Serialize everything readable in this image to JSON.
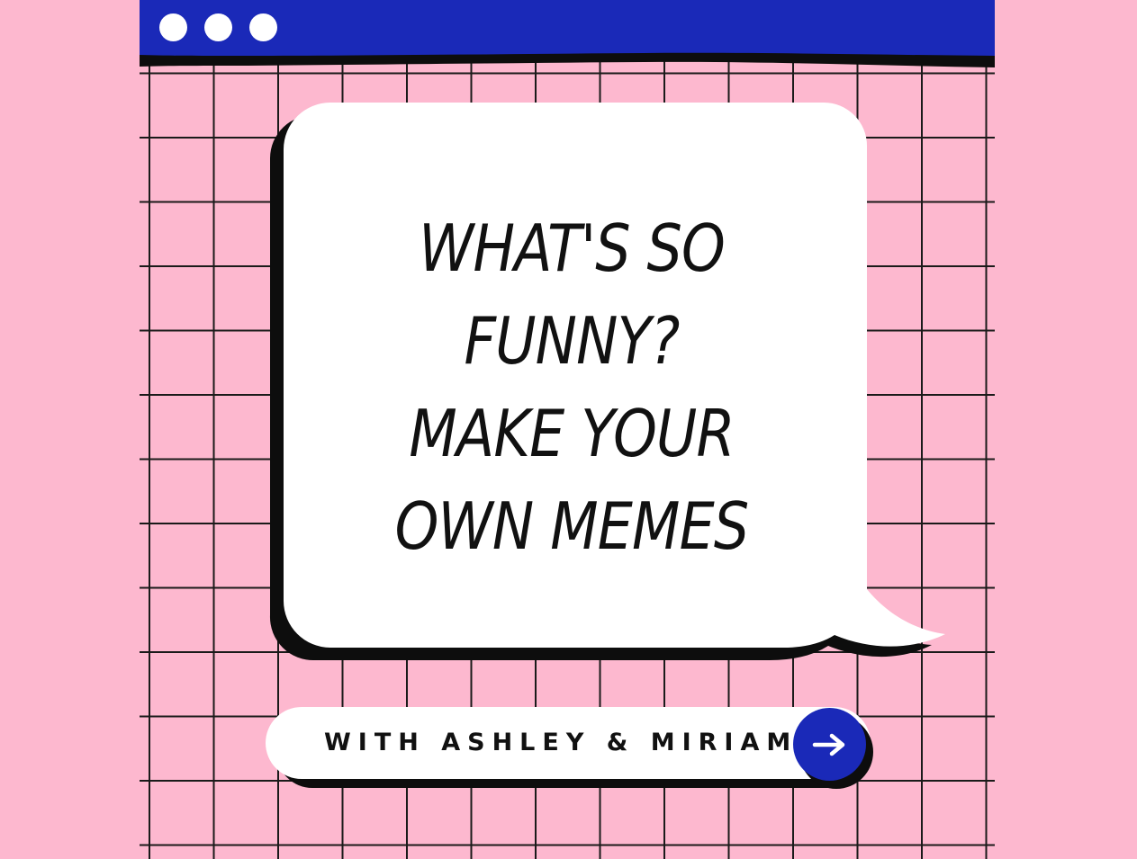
{
  "window": {
    "controls": [
      "dot",
      "dot",
      "dot"
    ],
    "bar_color": "#1a29b8"
  },
  "headline": {
    "lines": [
      "WHAT'S SO",
      "FUNNY?",
      "MAKE YOUR",
      "OWN MEMES"
    ]
  },
  "footer": {
    "label": "WITH ASHLEY & MIRIAM",
    "action_icon": "arrow-right-icon"
  },
  "colors": {
    "background": "#fdb8cf",
    "grid": "#1a1a1a",
    "accent": "#1a29b8",
    "bubble": "#ffffff",
    "text": "#111111"
  }
}
